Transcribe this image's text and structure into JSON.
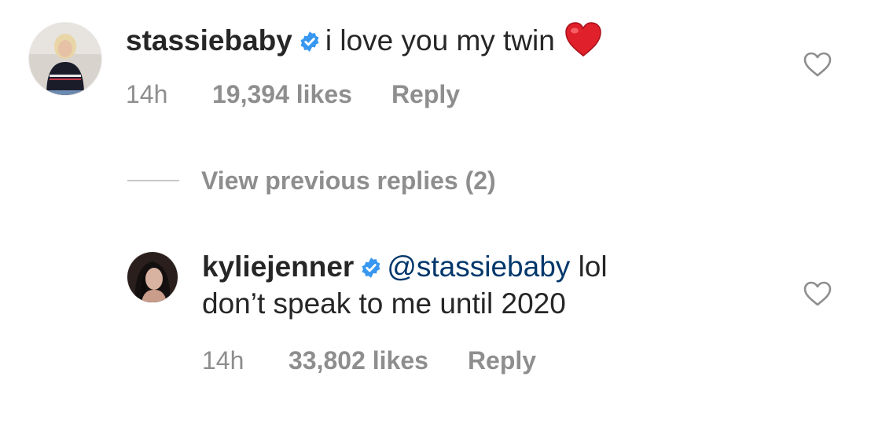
{
  "comments": [
    {
      "username": "stassiebaby",
      "text": "i love you my twin",
      "emoji": "❤️",
      "timestamp": "14h",
      "likes": "19,394 likes",
      "reply_label": "Reply",
      "verified": true
    },
    {
      "username": "kyliejenner",
      "mention": "@stassiebaby",
      "text_line1": " lol",
      "text_line2": "don’t speak to me until 2020",
      "timestamp": "14h",
      "likes": "33,802 likes",
      "reply_label": "Reply",
      "verified": true
    }
  ],
  "view_replies": {
    "label": "View previous replies (2)"
  },
  "colors": {
    "text": "#262626",
    "secondary": "#8e8e8e",
    "verified": "#3897f0",
    "mention": "#00376b",
    "heart_emoji": "#e0202a"
  },
  "icons": {
    "verified": "verified-badge-icon",
    "heart": "heart-outline-icon",
    "emoji": "red-heart-emoji"
  }
}
